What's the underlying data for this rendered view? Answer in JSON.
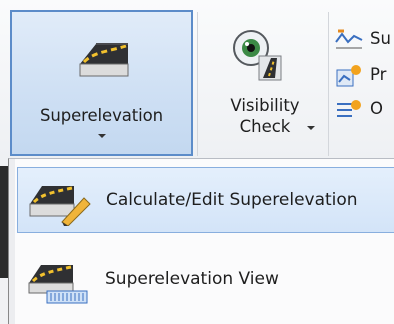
{
  "ribbon": {
    "superelevation": {
      "label": "Superelevation",
      "icon": "superelevation-road-icon"
    },
    "visibility_check": {
      "line1": "Visibility",
      "line2": "Check",
      "icon": "visibility-eye-icon"
    },
    "small_commands": [
      {
        "label": "Su",
        "icon": "superelevation-graph-icon"
      },
      {
        "label": "Pr",
        "icon": "profile-icon"
      },
      {
        "label": "O",
        "icon": "offset-icon"
      }
    ]
  },
  "menu": {
    "items": [
      {
        "label": "Calculate/Edit Superelevation",
        "icon": "calculate-edit-superelevation-icon",
        "highlighted": true
      },
      {
        "label": "Superelevation View",
        "icon": "superelevation-view-icon",
        "highlighted": false
      }
    ]
  },
  "colors": {
    "highlight_border": "#5c8cc9",
    "highlight_fill": "#cfe0f4",
    "menu_hover": "#d3e4f8"
  }
}
